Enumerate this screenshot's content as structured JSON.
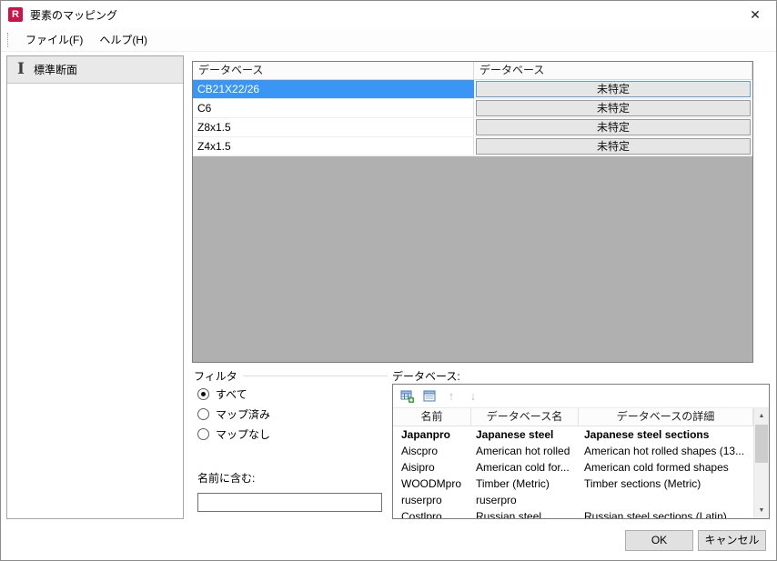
{
  "colors": {
    "selection_blue": "#3a95f4",
    "app_icon_red": "#c8134b",
    "grid_background_gray": "#b0b0b0",
    "button_face": "#e6e6e6"
  },
  "window": {
    "title": "要素のマッピング",
    "close_glyph": "✕",
    "app_icon_letter": "R"
  },
  "menu": {
    "items": [
      {
        "label": "ファイル(F)"
      },
      {
        "label": "ヘルプ(H)"
      }
    ]
  },
  "sidebar": {
    "items": [
      {
        "label": "標準断面",
        "selected": true
      }
    ]
  },
  "mapping": {
    "headers": [
      "データベース",
      "データベース"
    ],
    "rows": [
      {
        "name": "CB21X22/26",
        "value": "未特定",
        "selected": true
      },
      {
        "name": "C6",
        "value": "未特定",
        "selected": false
      },
      {
        "name": "Z8x1.5",
        "value": "未特定",
        "selected": false
      },
      {
        "name": "Z4x1.5",
        "value": "未特定",
        "selected": false
      }
    ]
  },
  "filter": {
    "title": "フィルタ",
    "options": [
      {
        "label": "すべて",
        "checked": true
      },
      {
        "label": "マップ済み",
        "checked": false
      },
      {
        "label": "マップなし",
        "checked": false
      }
    ],
    "name_label": "名前に含む:",
    "name_value": ""
  },
  "database": {
    "label": "データベース:",
    "toolbar": {
      "up_glyph": "↑",
      "down_glyph": "↓"
    },
    "columns": [
      "名前",
      "データベース名",
      "データベースの詳細"
    ],
    "rows": [
      {
        "name": "Japanpro",
        "db": "Japanese steel",
        "desc": "Japanese steel sections",
        "bold": true
      },
      {
        "name": "Aiscpro",
        "db": "American hot rolled",
        "desc": "American hot rolled shapes (13...",
        "bold": false
      },
      {
        "name": "Aisipro",
        "db": "American cold for...",
        "desc": "American cold formed shapes",
        "bold": false
      },
      {
        "name": "WOODMpro",
        "db": "Timber (Metric)",
        "desc": "Timber sections (Metric)",
        "bold": false
      },
      {
        "name": "ruserpro",
        "db": "ruserpro",
        "desc": "",
        "bold": false
      },
      {
        "name": "Costlpro",
        "db": "Russian steel",
        "desc": "Russian steel sections (Latin)",
        "bold": false
      }
    ],
    "scrollbar": {
      "up_glyph": "▲",
      "down_glyph": "▼"
    }
  },
  "footer": {
    "ok_label": "OK",
    "cancel_label": "キャンセル"
  }
}
